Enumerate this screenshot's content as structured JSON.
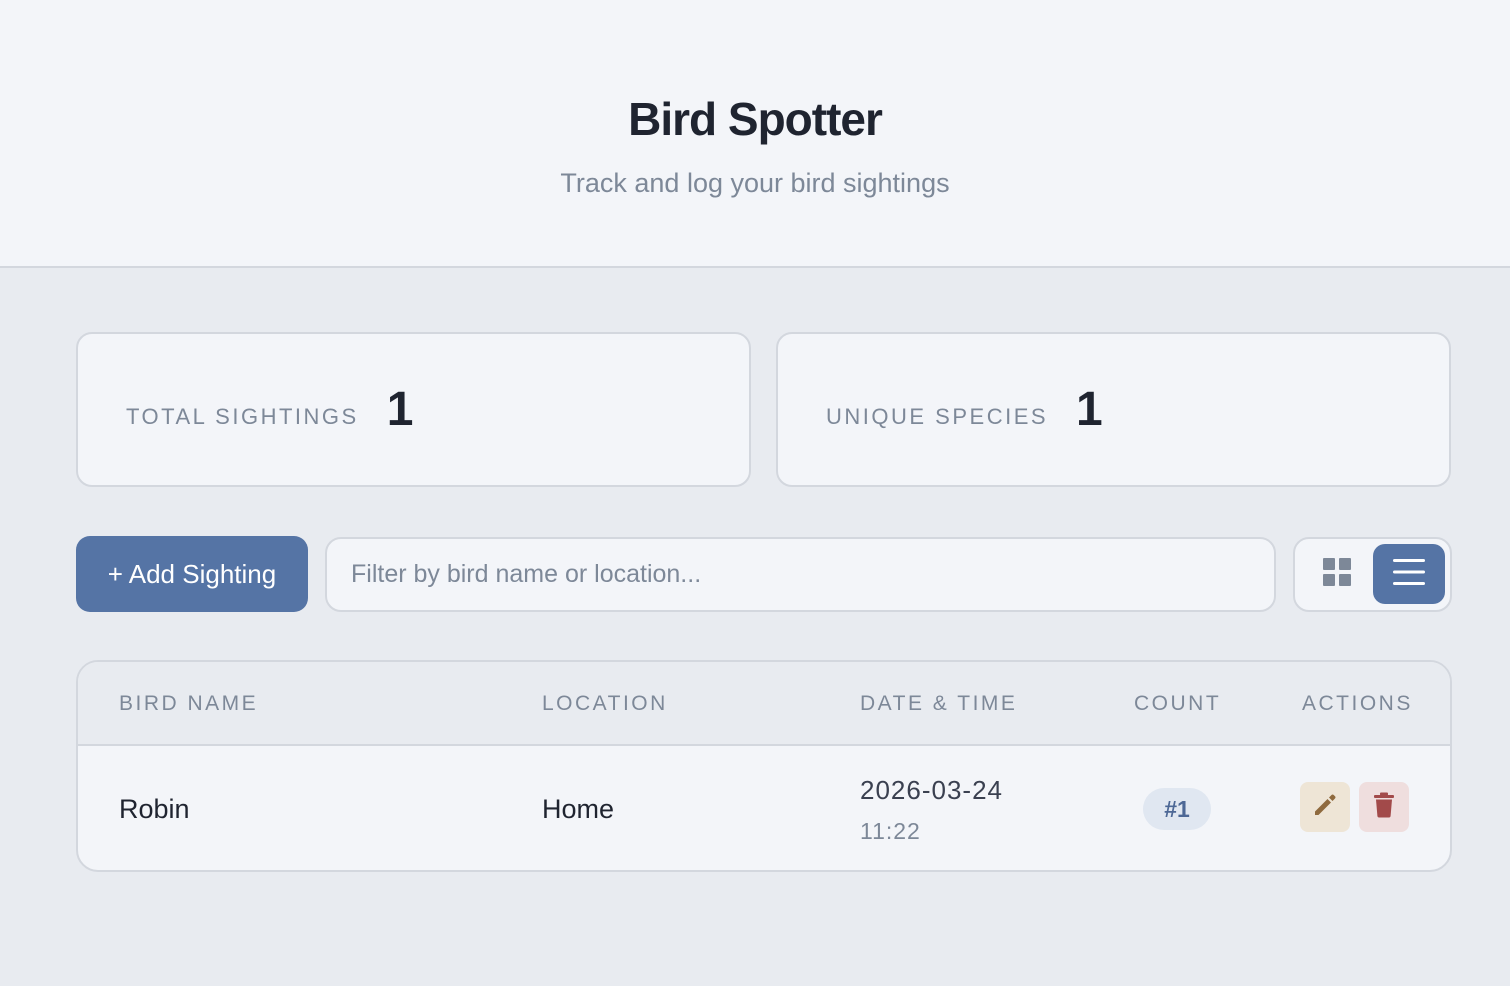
{
  "header": {
    "title": "Bird Spotter",
    "subtitle": "Track and log your bird sightings"
  },
  "stats": {
    "total_label": "TOTAL SIGHTINGS",
    "total_value": "1",
    "unique_label": "UNIQUE SPECIES",
    "unique_value": "1"
  },
  "toolbar": {
    "add_label": "+ Add Sighting",
    "filter_placeholder": "Filter by bird name or location...",
    "filter_value": "",
    "view_mode": "list"
  },
  "table": {
    "columns": [
      "BIRD NAME",
      "LOCATION",
      "DATE & TIME",
      "COUNT",
      "ACTIONS"
    ],
    "rows": [
      {
        "bird": "Robin",
        "location": "Home",
        "date": "2026-03-24",
        "time": "11:22",
        "count": "#1"
      }
    ]
  },
  "icons": {
    "grid": "grid-view-icon",
    "list": "list-view-icon",
    "edit": "pencil-icon",
    "delete": "trash-icon"
  },
  "colors": {
    "accent": "#5574a5",
    "background": "#e8ebf0",
    "card": "#f3f5f9",
    "edit_tint": "#eee5d6",
    "delete_tint": "#efdede"
  }
}
